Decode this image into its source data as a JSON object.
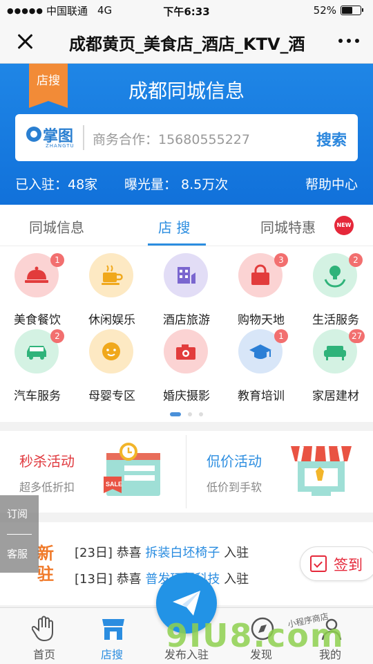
{
  "status_bar": {
    "signal": "●●●●●",
    "carrier": "中国联通",
    "network": "4G",
    "time": "下午6:33",
    "battery": "52%"
  },
  "nav": {
    "title": "成都黄页_美食店_酒店_KTV_酒"
  },
  "hero": {
    "badge": "店搜",
    "title": "成都同城信息",
    "logo_text": "掌图",
    "logo_sub": "ZHANGTU",
    "search_placeholder": "商务合作：15680555227",
    "search_button": "搜索",
    "joined": "已入驻：48家",
    "exposure": "曝光量：  8.5万次",
    "help": "帮助中心"
  },
  "tabs": {
    "items": [
      "同城信息",
      "店  搜",
      "同城特惠"
    ],
    "new_badge": "NEW"
  },
  "categories": [
    {
      "label": "美食餐饮",
      "badge": "1",
      "color": "#fbd3d3",
      "icon": "cloche-icon"
    },
    {
      "label": "休闲娱乐",
      "badge": "",
      "color": "#fde9c3",
      "icon": "coffee-icon"
    },
    {
      "label": "酒店旅游",
      "badge": "",
      "color": "#e2ddf6",
      "icon": "hotel-icon"
    },
    {
      "label": "购物天地",
      "badge": "3",
      "color": "#fbd3d3",
      "icon": "shopping-bag-icon"
    },
    {
      "label": "生活服务",
      "badge": "2",
      "color": "#d4f2e3",
      "icon": "lightbulb-icon"
    },
    {
      "label": "汽车服务",
      "badge": "2",
      "color": "#d4f2e3",
      "icon": "car-icon"
    },
    {
      "label": "母婴专区",
      "badge": "",
      "color": "#fde9c3",
      "icon": "baby-icon"
    },
    {
      "label": "婚庆摄影",
      "badge": "",
      "color": "#fbd3d3",
      "icon": "camera-icon"
    },
    {
      "label": "教育培训",
      "badge": "1",
      "color": "#d8e6f8",
      "icon": "graduation-cap-icon"
    },
    {
      "label": "家居建材",
      "badge": "27",
      "color": "#d4f2e3",
      "icon": "sofa-icon"
    }
  ],
  "promos": [
    {
      "title": "秒杀活动",
      "subtitle": "超多低折扣",
      "title_color": "#e0393e",
      "icon": "sale-calendar-icon",
      "sale_text": "SALE"
    },
    {
      "title": "侃价活动",
      "subtitle": "低价到手软",
      "title_color": "#2b8de0",
      "icon": "shop-stall-icon"
    }
  ],
  "news": {
    "label": "新驻",
    "items": [
      {
        "date": "[23日]",
        "text1": "恭喜",
        "name": "拆装白坯椅子",
        "text2": "入驻"
      },
      {
        "date": "[13日]",
        "text1": "恭喜",
        "name": "普发环保科技",
        "text2": "入驻"
      }
    ]
  },
  "checkin": {
    "label": "签到"
  },
  "side_tab": {
    "subscribe": "订阅",
    "service": "客服"
  },
  "bottom_nav": [
    {
      "label": "首页",
      "icon": "hand-icon"
    },
    {
      "label": "店搜",
      "icon": "store-icon"
    },
    {
      "label": "发布入驻",
      "icon": "paper-plane-icon"
    },
    {
      "label": "发现",
      "icon": "compass-icon"
    },
    {
      "label": "我的",
      "icon": "user-icon"
    }
  ],
  "watermark": {
    "text": "9IU8.com",
    "small": "小程序商店"
  }
}
